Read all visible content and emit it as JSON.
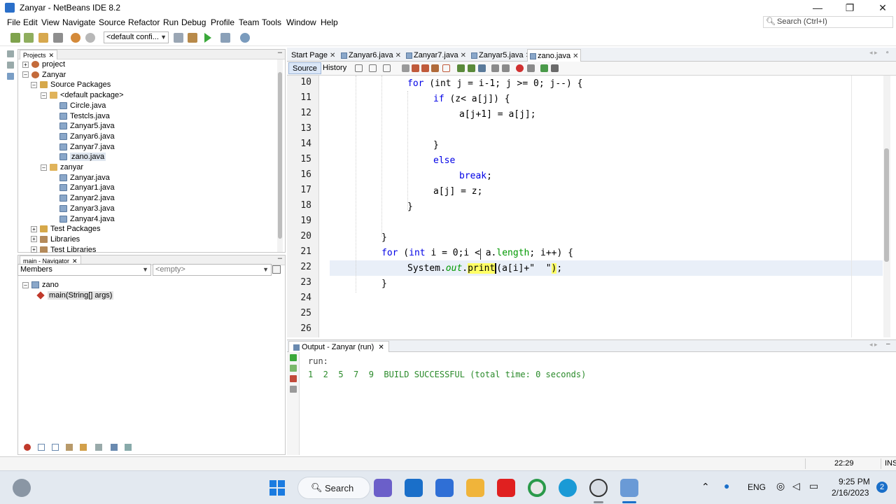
{
  "window": {
    "title": "Zanyar - NetBeans IDE 8.2",
    "minimize": "—",
    "maximize": "❐",
    "close": "✕"
  },
  "menu": [
    "File",
    "Edit",
    "View",
    "Navigate",
    "Source",
    "Refactor",
    "Run",
    "Debug",
    "Profile",
    "Team",
    "Tools",
    "Window",
    "Help"
  ],
  "search": {
    "placeholder": "Search (Ctrl+I)"
  },
  "toolbar": {
    "config_value": "<default confi..."
  },
  "projects": {
    "tab_label": "Projects",
    "tree": [
      {
        "label": "project",
        "kind": "project",
        "expanded": false,
        "level": 0
      },
      {
        "label": "Zanyar",
        "kind": "project",
        "expanded": true,
        "level": 0
      },
      {
        "label": "Source Packages",
        "kind": "pkgfolder",
        "expanded": true,
        "level": 1
      },
      {
        "label": "<default package>",
        "kind": "pkg",
        "expanded": true,
        "level": 2
      },
      {
        "label": "Circle.java",
        "kind": "java",
        "level": 3
      },
      {
        "label": "Testcls.java",
        "kind": "java",
        "level": 3
      },
      {
        "label": "Zanyar5.java",
        "kind": "java",
        "level": 3
      },
      {
        "label": "Zanyar6.java",
        "kind": "java",
        "level": 3
      },
      {
        "label": "Zanyar7.java",
        "kind": "java",
        "level": 3
      },
      {
        "label": "zano.java",
        "kind": "java",
        "level": 3,
        "selected": true
      },
      {
        "label": "zanyar",
        "kind": "pkg",
        "expanded": true,
        "level": 2
      },
      {
        "label": "Zanyar.java",
        "kind": "java",
        "level": 3
      },
      {
        "label": "Zanyar1.java",
        "kind": "java",
        "level": 3
      },
      {
        "label": "Zanyar2.java",
        "kind": "java",
        "level": 3
      },
      {
        "label": "Zanyar3.java",
        "kind": "java",
        "level": 3
      },
      {
        "label": "Zanyar4.java",
        "kind": "java",
        "level": 3
      },
      {
        "label": "Test Packages",
        "kind": "pkgfolder",
        "expanded": false,
        "level": 1
      },
      {
        "label": "Libraries",
        "kind": "lib",
        "expanded": false,
        "level": 1
      },
      {
        "label": "Test Libraries",
        "kind": "lib",
        "expanded": false,
        "level": 1
      }
    ]
  },
  "navigator": {
    "tab_label": "main - Navigator",
    "filter_value": "Members",
    "filter2_value": "<empty>",
    "root": "zano",
    "member": "main(String[] args)"
  },
  "editor": {
    "tabs": [
      {
        "label": "Start Page",
        "active": false
      },
      {
        "label": "Zanyar6.java",
        "active": false
      },
      {
        "label": "Zanyar7.java",
        "active": false
      },
      {
        "label": "Zanyar5.java",
        "active": false
      },
      {
        "label": "zano.java",
        "active": true
      }
    ],
    "views": {
      "source": "Source",
      "history": "History"
    },
    "line_numbers": [
      "10",
      "11",
      "12",
      "13",
      "14",
      "15",
      "16",
      "17",
      "18",
      "19",
      "20",
      "21",
      "22",
      "23",
      "24",
      "25",
      "26"
    ],
    "code": {
      "l10": {
        "kw": "for",
        "rest": " (int j = i-1; j >= 0; j--) {"
      },
      "l11": {
        "kw": "if",
        "rest": " (z< a[j]) {"
      },
      "l12": {
        "text": "a[j+1] = a[j];"
      },
      "l14": {
        "text": "}"
      },
      "l15": {
        "kw": "else"
      },
      "l16": {
        "kw": "break",
        "rest": ";"
      },
      "l17": {
        "text": "a[j] = z;"
      },
      "l18": {
        "text": "}"
      },
      "l20": {
        "text": "}"
      },
      "l21": {
        "kw": "for",
        "rest_a": " (",
        "kw2": "int",
        "rest_b": " i = 0;",
        "rest_c": "i < a.",
        "field": "length",
        "rest_d": "; i++) {"
      },
      "l22": {
        "cls": "System.",
        "field": "out",
        "dot": ".",
        "method": "print",
        "args": "(a[i]+\"  \"",
        "paren": ")",
        "semi": ";"
      },
      "l23": {
        "text": "}"
      }
    }
  },
  "output": {
    "tab_label": "Output - Zanyar (run)",
    "line1": "run:",
    "line2": "1  2  5  7  9  BUILD SUCCESSFUL (total time: 0 seconds)"
  },
  "status": {
    "caret_position": "22:29",
    "insert_mode": "INS"
  },
  "taskbar": {
    "search_label": "Search",
    "language": "ENG",
    "time": "9:25 PM",
    "date": "2/16/2023",
    "notification_count": "2"
  },
  "colors": {
    "keyword": "#0000e6",
    "field": "#009900",
    "string": "#ce7b00",
    "highlight": "#ffff66"
  }
}
